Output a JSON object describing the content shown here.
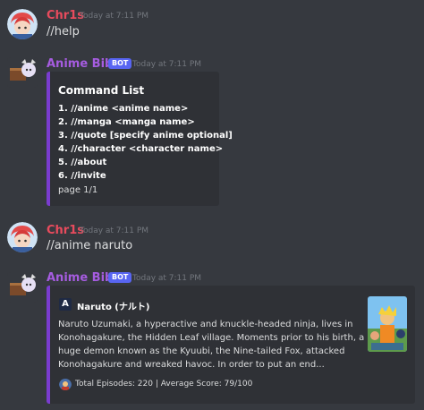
{
  "messages": [
    {
      "username": "Chr1s",
      "timestamp": "Today at 7:11 PM",
      "content": "//help"
    },
    {
      "username": "Anime Bible",
      "badge": "BOT",
      "timestamp": "Today at 7:11 PM",
      "embed": {
        "title": "Command List",
        "commands": [
          "1. //anime <anime name>",
          "2. //manga <manga name>",
          "3. //quote [specify anime optional]",
          "4. //character <character name>",
          "5. //about",
          "6. //invite"
        ],
        "footer": "page 1/1",
        "color": "#7a3ccf"
      }
    },
    {
      "username": "Chr1s",
      "timestamp": "Today at 7:11 PM",
      "content": "//anime naruto"
    },
    {
      "username": "Anime Bible",
      "badge": "BOT",
      "timestamp": "Today at 7:11 PM",
      "embed": {
        "author": "Naruto (ナルト)",
        "author_icon": "anilist-icon",
        "description_lines": [
          "Naruto Uzumaki, a hyperactive and knuckle-headed ninja, lives in",
          "Konohagakure, the Hidden Leaf village. Moments prior to his birth, a",
          "huge demon known as the Kyuubi, the Nine-tailed Fox, attacked",
          "Konohagakure and wreaked havoc. In order to put an end..."
        ],
        "footer": "Total Episodes: 220  |  Average Score: 79/100",
        "color": "#7a3ccf"
      }
    }
  ],
  "colors": {
    "background": "#36393f",
    "embed_bg": "#2f3136",
    "user_name": "#e84b5d",
    "bot_name": "#a65ce0",
    "bot_badge": "#5865f2"
  }
}
